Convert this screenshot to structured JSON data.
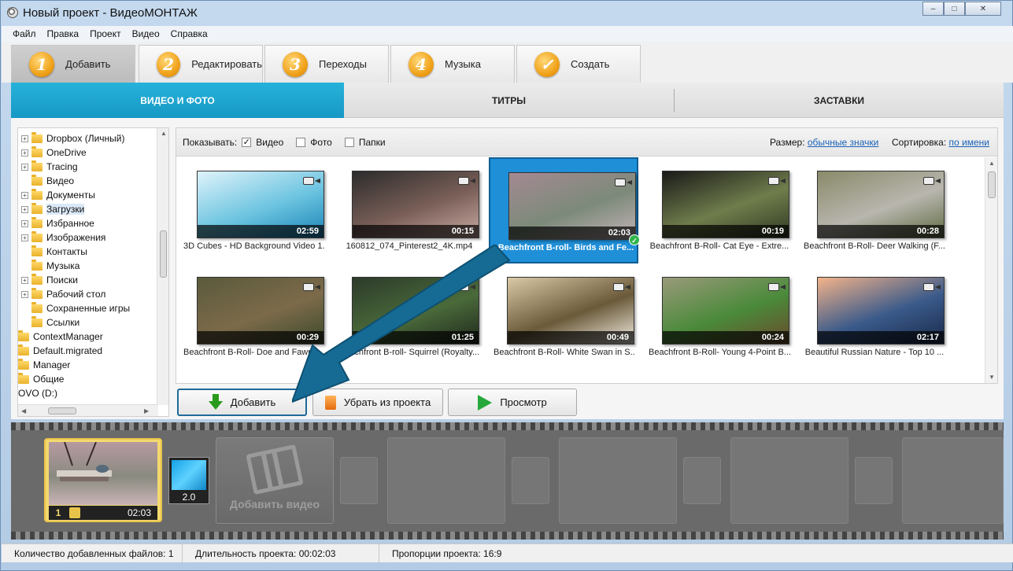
{
  "window": {
    "title": "Новый проект - ВидеоМОНТАЖ",
    "minimize": "–",
    "maximize": "□",
    "close": "✕"
  },
  "menu": [
    "Файл",
    "Правка",
    "Проект",
    "Видео",
    "Справка"
  ],
  "main_tabs": [
    {
      "num": "1",
      "label": "Добавить",
      "active": true
    },
    {
      "num": "2",
      "label": "Редактировать",
      "active": false
    },
    {
      "num": "3",
      "label": "Переходы",
      "active": false
    },
    {
      "num": "4",
      "label": "Музыка",
      "active": false
    },
    {
      "num": "✓",
      "label": "Создать",
      "active": false
    }
  ],
  "sub_tabs": [
    {
      "label": "ВИДЕО И ФОТО",
      "active": true
    },
    {
      "label": "ТИТРЫ",
      "active": false
    },
    {
      "label": "ЗАСТАВКИ",
      "active": false
    }
  ],
  "tree": [
    {
      "label": "Dropbox (Личный)",
      "expand": true
    },
    {
      "label": "OneDrive",
      "expand": true
    },
    {
      "label": "Tracing",
      "expand": true
    },
    {
      "label": "Видео",
      "expand": false
    },
    {
      "label": "Документы",
      "expand": true
    },
    {
      "label": "Загрузки",
      "expand": true,
      "selected": true
    },
    {
      "label": "Избранное",
      "expand": true
    },
    {
      "label": "Изображения",
      "expand": true
    },
    {
      "label": "Контакты",
      "expand": false
    },
    {
      "label": "Музыка",
      "expand": false
    },
    {
      "label": "Поиски",
      "expand": true
    },
    {
      "label": "Рабочий стол",
      "expand": true
    },
    {
      "label": "Сохраненные игры",
      "expand": false
    },
    {
      "label": "Ссылки",
      "expand": false
    },
    {
      "label": "ContextManager",
      "expand": false
    },
    {
      "label": "Default.migrated",
      "expand": false
    },
    {
      "label": "Manager",
      "expand": false
    },
    {
      "label": "Общие",
      "expand": false
    },
    {
      "label": "OVO (D:)",
      "expand": false
    }
  ],
  "filter": {
    "show_label": "Показывать:",
    "video_label": "Видео",
    "video_checked": "✓",
    "photo_label": "Фото",
    "folders_label": "Папки",
    "size_label": "Размер:",
    "size_value": "обычные значки",
    "sort_label": "Сортировка:",
    "sort_value": "по имени"
  },
  "videos": [
    {
      "title": "3D Cubes - HD Background Video 1...",
      "duration": "02:59",
      "colors": [
        "#dff3fb",
        "#6cc4e0",
        "#1b84b6"
      ]
    },
    {
      "title": "160812_074_Pinterest2_4K.mp4",
      "duration": "00:15",
      "colors": [
        "#2c2c2c",
        "#7a5f58",
        "#c8aaa2"
      ]
    },
    {
      "title": "Beachfront B-roll- Birds and Fe...",
      "duration": "02:03",
      "colors": [
        "#a48992",
        "#7c8a7a",
        "#c2b3b6"
      ],
      "selected": true
    },
    {
      "title": "Beachfront B-Roll- Cat Eye - Extre...",
      "duration": "00:19",
      "colors": [
        "#1a1a18",
        "#6f7d4c",
        "#2f3a22"
      ]
    },
    {
      "title": "Beachfront B-Roll- Deer Walking (F...",
      "duration": "00:28",
      "colors": [
        "#8a8a6a",
        "#b8b6ae",
        "#5f6b42"
      ]
    },
    {
      "title": "Beachfront B-Roll- Doe and Fawns ...",
      "duration": "00:29",
      "colors": [
        "#5a5a3c",
        "#7c6a4a",
        "#3c4a2c"
      ]
    },
    {
      "title": "Beachfront B-roll- Squirrel (Royalty...",
      "duration": "01:25",
      "colors": [
        "#2c3a2a",
        "#4a6a3a",
        "#1f281c"
      ]
    },
    {
      "title": "Beachfront B-Roll- White Swan in S...",
      "duration": "00:49",
      "colors": [
        "#d9c9a6",
        "#6a5a3a",
        "#f4eee2"
      ]
    },
    {
      "title": "Beachfront B-Roll- Young 4-Point B...",
      "duration": "00:24",
      "colors": [
        "#9a9a7a",
        "#4a8a3a",
        "#6a4a2c"
      ]
    },
    {
      "title": "Beautiful Russian Nature - Top 10 ...",
      "duration": "02:17",
      "colors": [
        "#f4b38a",
        "#3a5a8a",
        "#1a2a4a"
      ]
    }
  ],
  "actions": {
    "add": "Добавить",
    "remove": "Убрать из проекта",
    "preview": "Просмотр"
  },
  "timeline": {
    "clip_number": "1",
    "clip_duration": "02:03",
    "transition_value": "2.0",
    "add_video_label": "Добавить видео"
  },
  "status": {
    "files": "Количество добавленных файлов: 1",
    "duration": "Длительность проекта:   00:02:03",
    "ratio": "Пропорции проекта:   16:9"
  },
  "colors": {
    "accent": "#1aa3cf",
    "callout_arrow": "#166b95"
  }
}
